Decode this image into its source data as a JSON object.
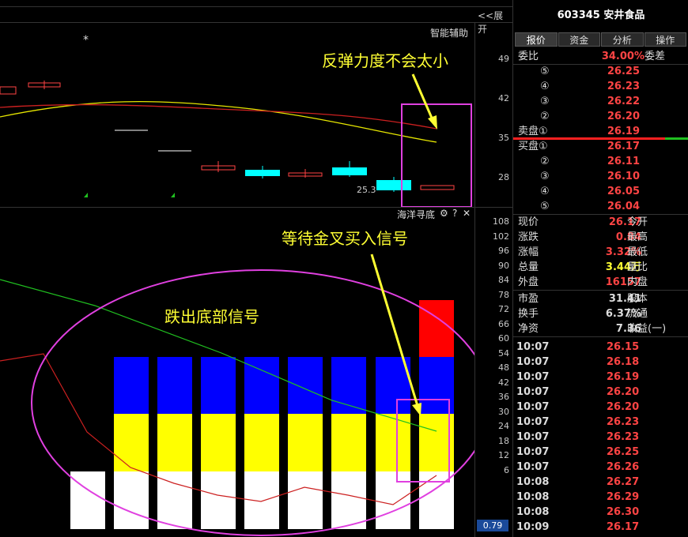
{
  "top_bar": {
    "expand_label": "<<展开",
    "indicator_label": "智能辅助"
  },
  "upper_axis": {
    "ticks": [
      "49",
      "42",
      "35",
      "28"
    ]
  },
  "upper_chart": {
    "star": "*",
    "price_label": "25.3",
    "annotation": "反弹力度不会太小"
  },
  "lower_panel": {
    "title": "海洋寻底",
    "gear": "⚙",
    "help": "?",
    "close": "✕",
    "annotation_top": "等待金叉买入信号",
    "annotation_mid": "跌出底部信号"
  },
  "lower_axis": {
    "ticks": [
      "108",
      "102",
      "96",
      "90",
      "84",
      "78",
      "72",
      "66",
      "60",
      "54",
      "48",
      "42",
      "36",
      "30",
      "24",
      "18",
      "12",
      "6"
    ],
    "current_value": "0.79"
  },
  "stock": {
    "code": "603345",
    "name": "安井食品"
  },
  "tabs": [
    "报价",
    "资金",
    "分析",
    "操作"
  ],
  "webi": {
    "label": "委比",
    "value": "34.00%",
    "label2": "委差"
  },
  "ask": [
    {
      "label": "⑤",
      "price": "26.25"
    },
    {
      "label": "④",
      "price": "26.23"
    },
    {
      "label": "③",
      "price": "26.22"
    },
    {
      "label": "②",
      "price": "26.20"
    },
    {
      "label": "卖盘①",
      "price": "26.19"
    }
  ],
  "bid": [
    {
      "label": "买盘①",
      "price": "26.17"
    },
    {
      "label": "②",
      "price": "26.11"
    },
    {
      "label": "③",
      "price": "26.10"
    },
    {
      "label": "④",
      "price": "26.05"
    },
    {
      "label": "⑤",
      "price": "26.04"
    }
  ],
  "quote": [
    {
      "label": "现价",
      "value": "26.17",
      "label2": "今开",
      "color": "#ff4444"
    },
    {
      "label": "涨跌",
      "value": "0.84",
      "label2": "最高",
      "color": "#ff4444"
    },
    {
      "label": "涨幅",
      "value": "3.32%",
      "label2": "最低",
      "color": "#ff4444"
    },
    {
      "label": "总量",
      "value": "3.44万",
      "label2": "量比",
      "color": "#ffff33"
    },
    {
      "label": "外盘",
      "value": "16157",
      "label2": "内盘",
      "color": "#ff4444"
    },
    {
      "label": "市盈",
      "value": "31.41",
      "label2": "股本",
      "color": "#dddddd"
    },
    {
      "label": "换手",
      "value": "6.37%",
      "label2": "流通",
      "color": "#dddddd"
    },
    {
      "label": "净资",
      "value": "7.36",
      "label2": "收益(一)",
      "color": "#dddddd"
    }
  ],
  "trades": [
    {
      "time": "10:07",
      "price": "26.15"
    },
    {
      "time": "10:07",
      "price": "26.18"
    },
    {
      "time": "10:07",
      "price": "26.19"
    },
    {
      "time": "10:07",
      "price": "26.20"
    },
    {
      "time": "10:07",
      "price": "26.20"
    },
    {
      "time": "10:07",
      "price": "26.23"
    },
    {
      "time": "10:07",
      "price": "26.23"
    },
    {
      "time": "10:07",
      "price": "26.25"
    },
    {
      "time": "10:07",
      "price": "26.26"
    },
    {
      "time": "10:08",
      "price": "26.27"
    },
    {
      "time": "10:08",
      "price": "26.29"
    },
    {
      "time": "10:08",
      "price": "26.30"
    },
    {
      "time": "10:09",
      "price": "26.17"
    }
  ],
  "colors": {
    "up": "#ff4444",
    "down": "#00ffff",
    "ma_yellow": "#e6e600",
    "ma_red": "#cc2020",
    "ma_green": "#20c020",
    "highlight": "#e040e0",
    "bar_blue": "#0000ff",
    "bar_yellow": "#ffff00",
    "bar_white": "#ffffff",
    "bar_red": "#ff0000"
  }
}
